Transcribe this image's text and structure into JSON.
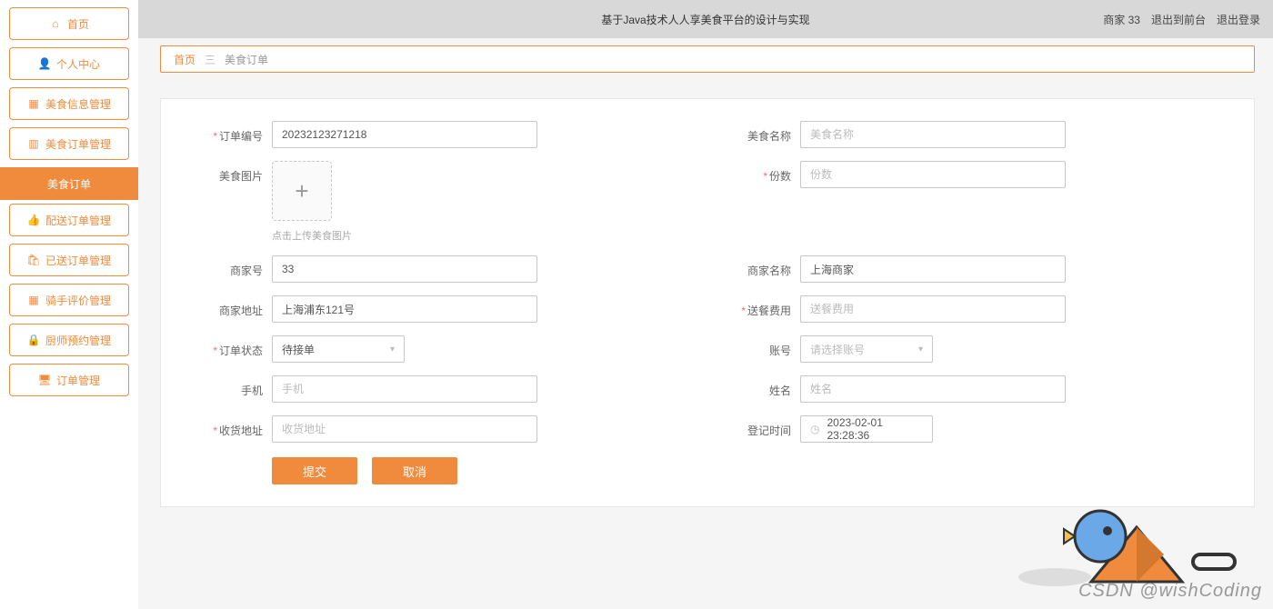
{
  "header": {
    "title": "基于Java技术人人享美食平台的设计与实现",
    "user": "商家 33",
    "toFront": "退出到前台",
    "logout": "退出登录"
  },
  "sidebar": {
    "items": [
      {
        "icon": "home-icon",
        "label": "首页"
      },
      {
        "icon": "user-icon",
        "label": "个人中心"
      },
      {
        "icon": "grid-icon",
        "label": "美食信息管理"
      },
      {
        "icon": "chart-icon",
        "label": "美食订单管理"
      },
      {
        "icon": "",
        "label": "美食订单",
        "active": true
      },
      {
        "icon": "thumb-icon",
        "label": "配送订单管理"
      },
      {
        "icon": "bag-icon",
        "label": "已送订单管理"
      },
      {
        "icon": "grid2-icon",
        "label": "骑手评价管理"
      },
      {
        "icon": "lock-icon",
        "label": "厨师预约管理"
      },
      {
        "icon": "monitor-icon",
        "label": "订单管理"
      }
    ]
  },
  "breadcrumb": {
    "home": "首页",
    "sep": "三",
    "current": "美食订单"
  },
  "form": {
    "orderNo": {
      "label": "订单编号",
      "value": "20232123271218",
      "required": true
    },
    "foodName": {
      "label": "美食名称",
      "placeholder": "美食名称"
    },
    "foodImage": {
      "label": "美食图片",
      "hint": "点击上传美食图片"
    },
    "qty": {
      "label": "份数",
      "placeholder": "份数",
      "required": true
    },
    "merchantNo": {
      "label": "商家号",
      "value": "33"
    },
    "merchantName": {
      "label": "商家名称",
      "value": "上海商家"
    },
    "merchantAddr": {
      "label": "商家地址",
      "value": "上海浦东121号"
    },
    "deliveryFee": {
      "label": "送餐费用",
      "placeholder": "送餐费用",
      "required": true
    },
    "orderStatus": {
      "label": "订单状态",
      "value": "待接单",
      "required": true
    },
    "account": {
      "label": "账号",
      "placeholder": "请选择账号"
    },
    "phone": {
      "label": "手机",
      "placeholder": "手机"
    },
    "name": {
      "label": "姓名",
      "placeholder": "姓名"
    },
    "recvAddr": {
      "label": "收货地址",
      "placeholder": "收货地址",
      "required": true
    },
    "regTime": {
      "label": "登记时间",
      "value": "2023-02-01 23:28:36"
    }
  },
  "buttons": {
    "submit": "提交",
    "cancel": "取消"
  },
  "watermark": "CSDN @wishCoding",
  "colors": {
    "accent": "#f08b3e"
  }
}
